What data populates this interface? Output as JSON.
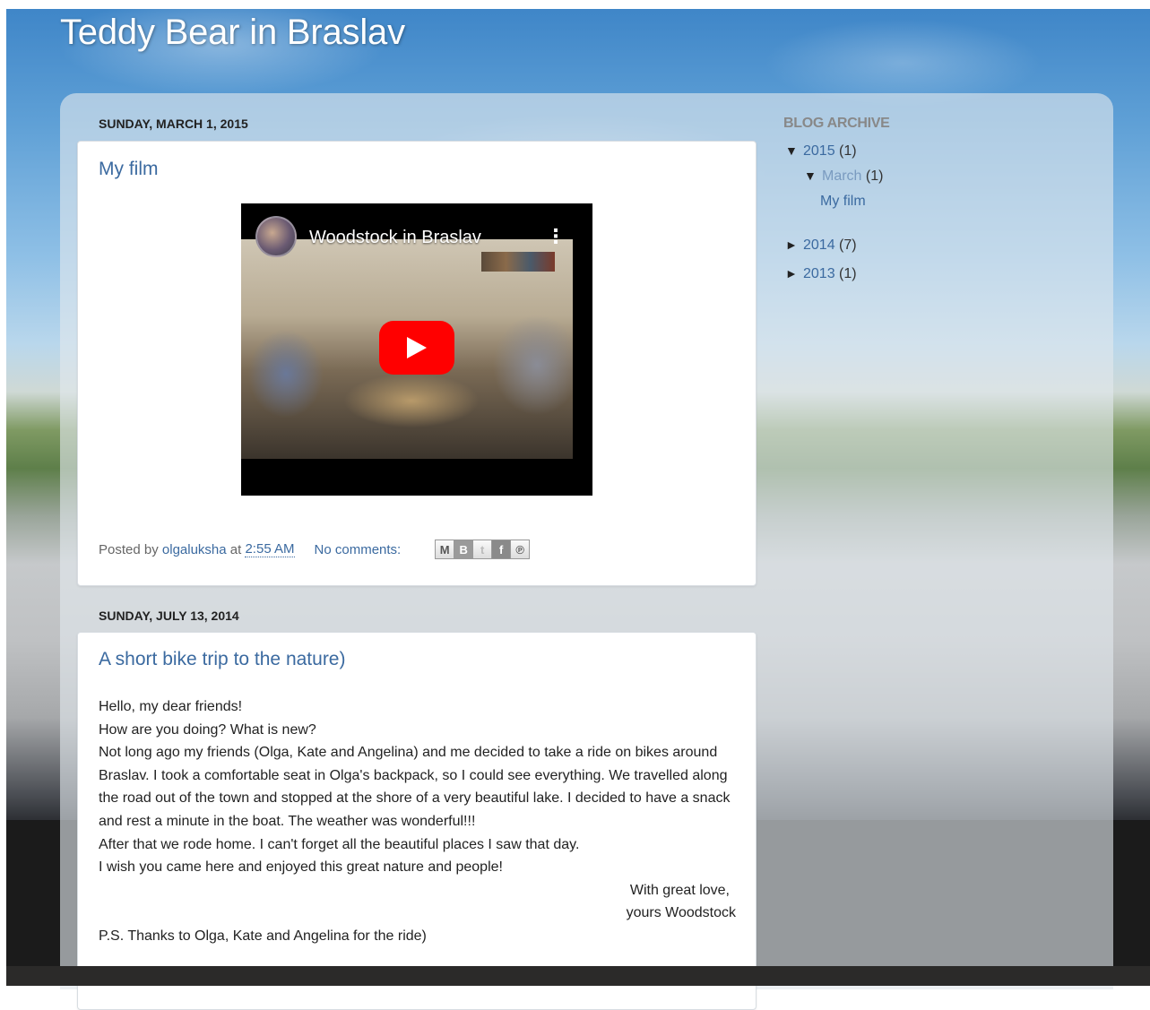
{
  "blog": {
    "title": "Teddy Bear in Braslav"
  },
  "posts": [
    {
      "date": "SUNDAY, MARCH 1, 2015",
      "title": "My film",
      "video": {
        "title": "Woodstock in Braslav",
        "menu": "⋮"
      },
      "footer": {
        "posted_by": "Posted by",
        "author": "olgaluksha",
        "at": "at",
        "time": "2:55 AM",
        "comments": "No comments:"
      },
      "share": [
        "M",
        "B",
        "t",
        "f",
        "℗"
      ]
    },
    {
      "date": "SUNDAY, JULY 13, 2014",
      "title": "A short bike trip to the nature)",
      "body": [
        "Hello, my dear friends!",
        "How are you doing? What is new?",
        "Not long ago my friends (Olga, Kate and Angelina) and me decided to take a ride on bikes around Braslav. I took a comfortable seat in Olga's backpack, so I could see everything. We travelled along the road out of the town and stopped at the shore of a very beautiful lake. I decided to have a snack and rest a minute in the boat. The weather was wonderful!!!",
        "After that we rode home. I can't forget all the beautiful places I saw that day.",
        "I wish you came here and enjoyed this great nature and people!"
      ],
      "signature": [
        "With great love,",
        "yours Woodstock"
      ],
      "ps": "P.S. Thanks to Olga, Kate and Angelina for the ride)"
    }
  ],
  "sidebar": {
    "title": "BLOG ARCHIVE",
    "archive": {
      "y2015": {
        "toggle": "▼",
        "label": "2015",
        "count": "(1)"
      },
      "march": {
        "toggle": "▼",
        "label": "March",
        "count": "(1)"
      },
      "myfilm": {
        "label": "My film"
      },
      "y2014": {
        "toggle": "►",
        "label": "2014",
        "count": "(7)"
      },
      "y2013": {
        "toggle": "►",
        "label": "2013",
        "count": "(1)"
      }
    }
  },
  "colors": {
    "link": "#3b6aa0",
    "play": "#ff0000"
  }
}
